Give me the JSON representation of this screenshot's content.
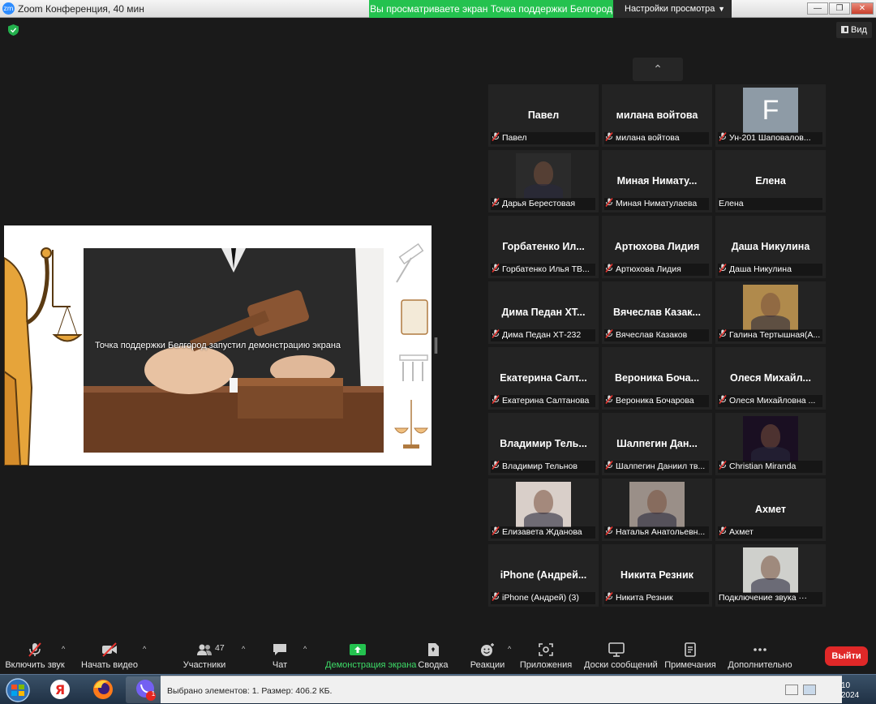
{
  "window": {
    "app_logo": "zm",
    "title": "Zoom Конференция, 40 мин",
    "share_banner": "Вы просматриваете экран Точка поддержки Белгород",
    "view_settings": "Настройки просмотра",
    "minimize": "—",
    "restore": "❐",
    "close": "✕"
  },
  "top": {
    "view_label": "Вид"
  },
  "share": {
    "caption": "Точка поддержки Белгород запустил демонстрацию экрана"
  },
  "gallery": {
    "up_arrow": "⌃",
    "tiles": [
      {
        "big": "Павел",
        "label": "Павел",
        "kind": "name"
      },
      {
        "big": "милана войтова",
        "label": "милана войтова",
        "kind": "name"
      },
      {
        "big": "F",
        "label": "Ун-201 Шаповалов...",
        "kind": "letter",
        "color": "#8e9ba6"
      },
      {
        "big": "",
        "label": "Дарья Берестовая",
        "kind": "photo",
        "color": "#2b2b2b"
      },
      {
        "big": "Миная Нимату...",
        "label": "Миная Ниматулаева",
        "kind": "name"
      },
      {
        "big": "Елена",
        "label": "Елена",
        "kind": "name",
        "nomic": true
      },
      {
        "big": "Горбатенко Ил...",
        "label": "Горбатенко Илья ТВ...",
        "kind": "name"
      },
      {
        "big": "Артюхова Лидия",
        "label": "Артюхова Лидия",
        "kind": "name"
      },
      {
        "big": "Даша Никулина",
        "label": "Даша Никулина",
        "kind": "name"
      },
      {
        "big": "Дима Педан ХТ...",
        "label": "Дима Педан ХТ-232",
        "kind": "name"
      },
      {
        "big": "Вячеслав Казак...",
        "label": "Вячеслав Казаков",
        "kind": "name"
      },
      {
        "big": "",
        "label": "Галина Тертышная(А...",
        "kind": "photo",
        "color": "#b08a4c"
      },
      {
        "big": "Екатерина Салт...",
        "label": "Екатерина Салтанова",
        "kind": "name"
      },
      {
        "big": "Вероника Боча...",
        "label": "Вероника Бочарова",
        "kind": "name"
      },
      {
        "big": "Олеся Михайл...",
        "label": "Олеся Михайловна ...",
        "kind": "name"
      },
      {
        "big": "Владимир Тель...",
        "label": "Владимир Тельнов",
        "kind": "name"
      },
      {
        "big": "Шалпегин Дан...",
        "label": "Шалпегин Даниил тв...",
        "kind": "name"
      },
      {
        "big": "",
        "label": "Christian Miranda",
        "kind": "photo",
        "color": "#1a0f22"
      },
      {
        "big": "",
        "label": "Елизавета Жданова",
        "kind": "photo",
        "color": "#d9cfc9"
      },
      {
        "big": "",
        "label": "Наталья Анатольевн...",
        "kind": "photo",
        "color": "#9a8f88"
      },
      {
        "big": "Ахмет",
        "label": "Ахмет",
        "kind": "name"
      },
      {
        "big": "iPhone (Андрей...",
        "label": "iPhone (Андрей) (3)",
        "kind": "name"
      },
      {
        "big": "Никита Резник",
        "label": "Никита Резник",
        "kind": "name"
      },
      {
        "big": "",
        "label": "Подключение звука ···",
        "kind": "photo",
        "color": "#cfd0cc",
        "nomic": true
      }
    ]
  },
  "toolbar": {
    "unmute": "Включить звук",
    "start_video": "Начать видео",
    "participants": "Участники",
    "participants_count": "47",
    "chat": "Чат",
    "share_screen": "Демонстрация экрана",
    "summary": "Сводка",
    "reactions": "Реакции",
    "apps": "Приложения",
    "whiteboards": "Доски сообщений",
    "notes": "Примечания",
    "more": "Дополнительно",
    "leave": "Выйти"
  },
  "taskbar": {
    "explorer_status": "Выбрано элементов: 1. Размер: 406.2 КБ.",
    "clock_line1": "10",
    "clock_line2": "2024",
    "notification_count": "1"
  },
  "colors": {
    "share_green": "#24c24f",
    "leave_red": "#e02828",
    "muted_red": "#e8342f",
    "tile_bg": "#232323"
  }
}
